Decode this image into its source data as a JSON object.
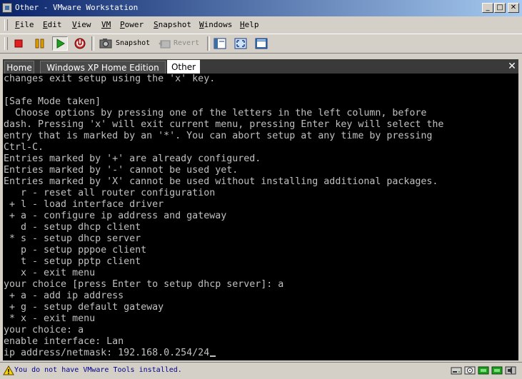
{
  "window": {
    "title": "Other - VMware Workstation"
  },
  "menu": {
    "items": [
      {
        "label": "File",
        "mnemonic": "F",
        "rest": "ile"
      },
      {
        "label": "Edit",
        "mnemonic": "E",
        "rest": "dit"
      },
      {
        "label": "View",
        "mnemonic": "V",
        "rest": "iew"
      },
      {
        "label": "VM",
        "mnemonic": "VM",
        "rest": ""
      },
      {
        "label": "Power",
        "mnemonic": "P",
        "rest": "ower"
      },
      {
        "label": "Snapshot",
        "mnemonic": "S",
        "rest": "napshot"
      },
      {
        "label": "Windows",
        "mnemonic": "W",
        "rest": "indows"
      },
      {
        "label": "Help",
        "mnemonic": "H",
        "rest": "elp"
      }
    ]
  },
  "toolbar": {
    "snapshot_label": "Snapshot",
    "revert_label": "Revert",
    "colors": {
      "stop": "#e02020",
      "pause": "#e0a000",
      "play": "#20a020",
      "reset": "#c03030"
    },
    "icons": [
      "stop-icon",
      "pause-icon",
      "play-icon",
      "reset-icon",
      "snapshot-icon",
      "revert-icon",
      "quick-switch-icon",
      "full-screen-icon",
      "summary-view-icon"
    ]
  },
  "tabs": [
    {
      "label": "Home",
      "active": false
    },
    {
      "label": "Windows XP Home Edition",
      "active": false
    },
    {
      "label": "Other",
      "active": true
    }
  ],
  "console": {
    "lines": [
      "changes exit setup using the 'x' key.",
      "",
      "[Safe Mode taken]",
      "  Choose options by pressing one of the letters in the left column, before",
      "dash. Pressing 'x' will exit current menu, pressing Enter key will select the",
      "entry that is marked by an '*'. You can abort setup at any time by pressing",
      "Ctrl-C.",
      "Entries marked by '+' are already configured.",
      "Entries marked by '-' cannot be used yet.",
      "Entries marked by 'X' cannot be used without installing additional packages.",
      "   r - reset all router configuration",
      " + l - load interface driver",
      " + a - configure ip address and gateway",
      "   d - setup dhcp client",
      " * s - setup dhcp server",
      "   p - setup pppoe client",
      "   t - setup pptp client",
      "   x - exit menu",
      "your choice [press Enter to setup dhcp server]: a",
      " + a - add ip address",
      " + g - setup default gateway",
      " * x - exit menu",
      "your choice: a",
      "enable interface: Lan",
      "ip address/netmask: 192.168.0.254/24"
    ]
  },
  "status": {
    "message": "You do not have VMware Tools installed.",
    "icons": [
      "warning-icon",
      "hard-disk-icon",
      "cdrom-icon",
      "network-icon",
      "network-icon-2",
      "sound-icon"
    ]
  }
}
